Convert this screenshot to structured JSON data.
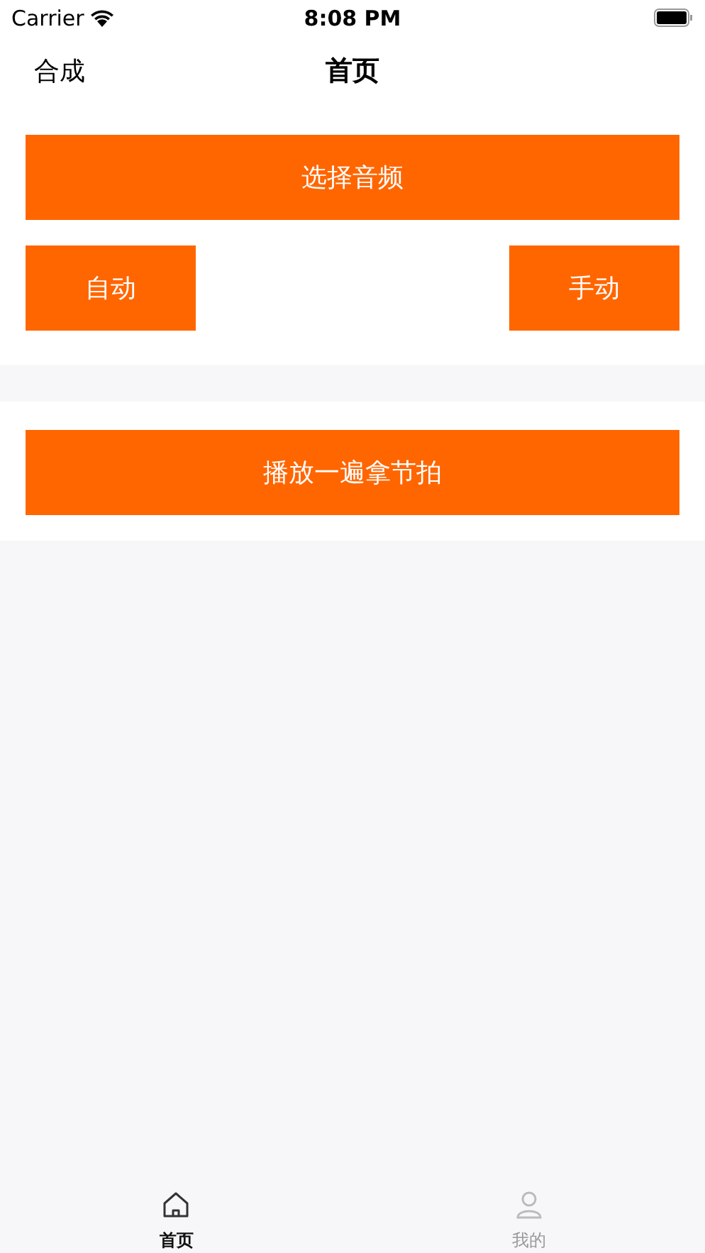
{
  "status_bar": {
    "carrier": "Carrier",
    "time": "8:08 PM"
  },
  "nav_bar": {
    "left": "合成",
    "title": "首页"
  },
  "section_1": {
    "main_button": "选择音频",
    "left_button": "自动",
    "right_button": "手动"
  },
  "section_2": {
    "main_button": "播放一遍拿节拍"
  },
  "tab_bar": [
    {
      "label": "首页",
      "kind": "home",
      "selected": true
    },
    {
      "label": "我的",
      "kind": "person",
      "selected": false
    }
  ]
}
